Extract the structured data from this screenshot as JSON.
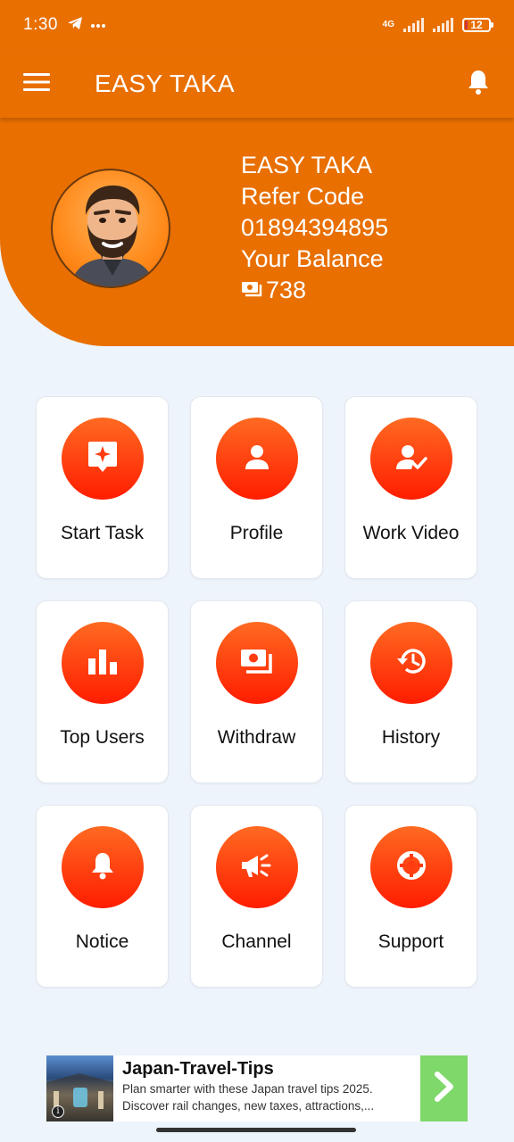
{
  "status_bar": {
    "time": "1:30",
    "network": "4G",
    "battery": "12",
    "battery_fraction": 0.12
  },
  "app_bar": {
    "title": "EASY TAKA",
    "menu_icon": "hamburger-menu-icon",
    "bell_icon": "bell-icon"
  },
  "header": {
    "name": "EASY TAKA",
    "refer_label": "Refer Code",
    "refer_code": "01894394895",
    "balance_label": "Your Balance",
    "balance_value": "738"
  },
  "menu": [
    {
      "label": "Start Task",
      "icon": "task-sparkle-icon"
    },
    {
      "label": "Profile",
      "icon": "person-icon"
    },
    {
      "label": "Work Video",
      "icon": "person-check-icon"
    },
    {
      "label": "Top Users",
      "icon": "bar-chart-icon"
    },
    {
      "label": "Withdraw",
      "icon": "cash-icon"
    },
    {
      "label": "History",
      "icon": "history-icon"
    },
    {
      "label": "Notice",
      "icon": "bell-icon"
    },
    {
      "label": "Channel",
      "icon": "megaphone-icon"
    },
    {
      "label": "Support",
      "icon": "lifebuoy-icon"
    }
  ],
  "ad": {
    "title": "Japan-Travel-Tips",
    "description": "Plan smarter with these Japan travel tips 2025. Discover rail changes, new taxes, attractions,..."
  },
  "colors": {
    "primary": "#e86f00",
    "tile_gradient_top": "#ff6a22",
    "tile_gradient_bottom": "#ff1d00",
    "background": "#eef4fb"
  }
}
